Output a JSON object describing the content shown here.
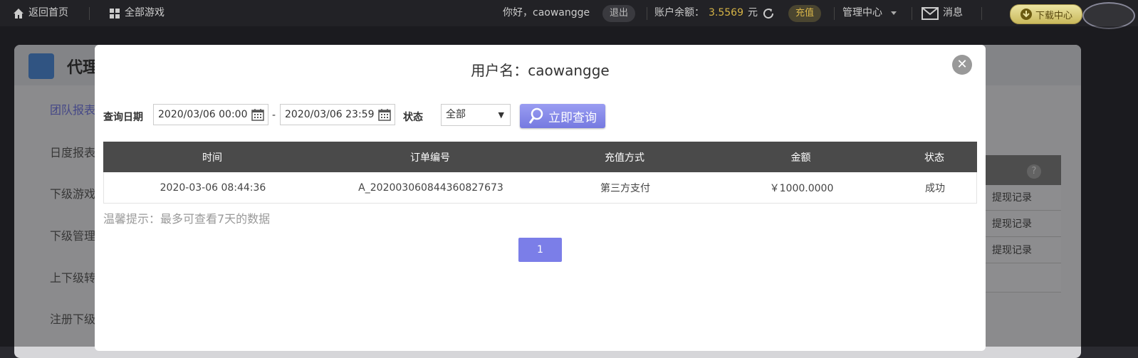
{
  "topbar": {
    "home_label": "返回首页",
    "all_games_label": "全部游戏",
    "greeting": "你好，caowangge",
    "logout_label": "退出",
    "balance_label": "账户余额：",
    "balance_value": "3.5569",
    "balance_unit": "元",
    "recharge_label": "充值",
    "manage_label": "管理中心",
    "message_label": "消息",
    "download_label": "下载中心"
  },
  "background": {
    "page_title": "代理",
    "nav": [
      "团队报表",
      "日度报表",
      "下级游戏",
      "下级管理",
      "上下级转",
      "注册下级"
    ],
    "right_links": [
      "提现记录",
      "提现记录",
      "提现记录"
    ],
    "help_icon": "?"
  },
  "modal": {
    "title": "用户名：caowangge",
    "query_date_label": "查询日期",
    "start_date": "2020/03/06 00:00",
    "end_date": "2020/03/06 23:59",
    "date_separator": "-",
    "status_label": "状态",
    "status_selected": "全部",
    "query_button": "立即查询",
    "table": {
      "headers": [
        "时间",
        "订单编号",
        "充值方式",
        "金额",
        "状态"
      ],
      "rows": [
        {
          "time": "2020-03-06 08:44:36",
          "order_no": "A_20200306084436082767​3",
          "method": "第三方支付",
          "amount": "￥1000.0000",
          "status": "成功"
        }
      ]
    },
    "tip": "温馨提示：最多可查看7天的数据",
    "pagination": {
      "current_page": "1"
    }
  },
  "colors": {
    "accent": "#7b7ee8",
    "table_header": "#4a4a4a",
    "balance": "#d6b446"
  }
}
